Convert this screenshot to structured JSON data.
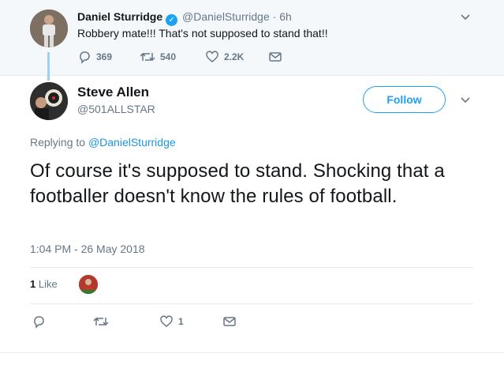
{
  "parent_tweet": {
    "author_name": "Daniel Sturridge",
    "author_handle": "@DanielSturridge",
    "separator": "·",
    "time": "6h",
    "text": "Robbery mate!!! That's not supposed to stand that!!",
    "replies": "369",
    "retweets": "540",
    "likes": "2.2K"
  },
  "main_tweet": {
    "author_name": "Steve Allen",
    "author_handle": "@501ALLSTAR",
    "follow_label": "Follow",
    "replying_to_label": "Replying to",
    "replying_to_handle": "@DanielSturridge",
    "text": "Of course it's supposed to stand. Shocking that a footballer doesn't know the rules of football.",
    "timestamp": "1:04 PM - 26 May 2018",
    "like_count": "1",
    "like_label": "Like",
    "action_likes": "1"
  },
  "colors": {
    "accent": "#1da1f2",
    "muted": "#657786",
    "text": "#14171a",
    "thread_line": "#9cd1f5"
  },
  "icons": [
    "verified-icon",
    "chevron-down-icon",
    "reply-icon",
    "retweet-icon",
    "heart-icon",
    "envelope-icon"
  ]
}
